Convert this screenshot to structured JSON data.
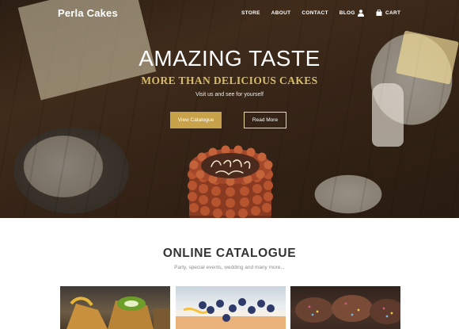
{
  "brand": {
    "name": "Perla Cakes"
  },
  "nav": {
    "items": [
      "STORE",
      "ABOUT",
      "CONTACT",
      "BLOG"
    ],
    "user_icon": "user-icon",
    "cart_icon": "shopping-bag-icon",
    "cart_label": "CART"
  },
  "hero": {
    "headline": "AMAZING TASTE",
    "subheadline": "MORE THAN DELICIOUS CAKES",
    "tagline": "Visit us and see for yourself",
    "primary_button": "View Catalogue",
    "secondary_button": "Read More",
    "cake_inscription": "Happy Birthday",
    "accent_color": "#c7a24b"
  },
  "catalogue": {
    "title": "ONLINE CATALOGUE",
    "subtitle": "Party, special events, wedding and many more..."
  }
}
